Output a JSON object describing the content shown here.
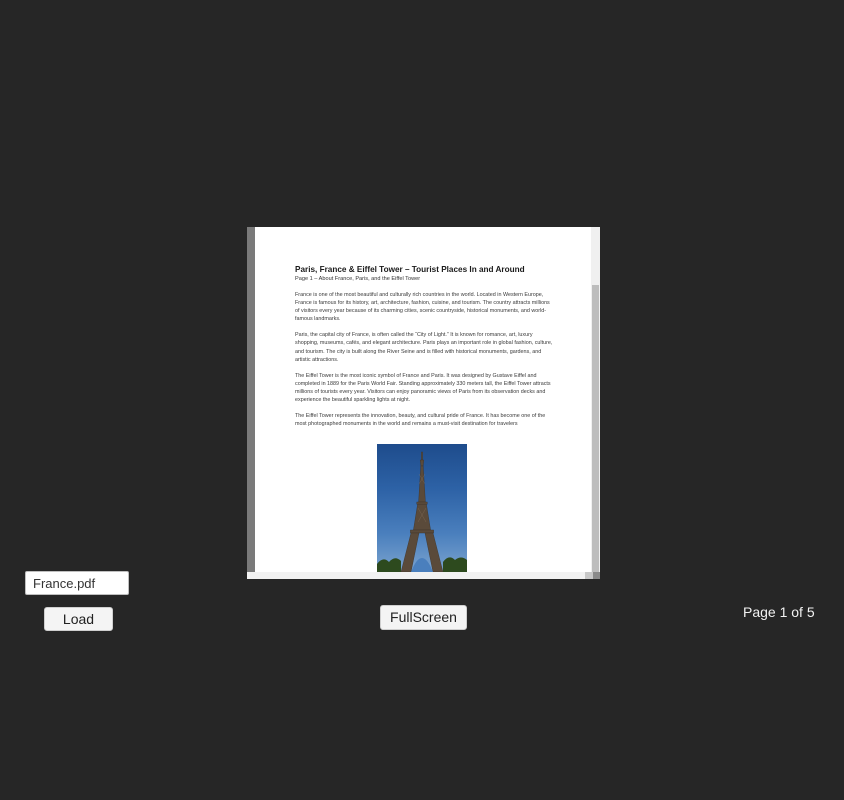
{
  "viewer": {
    "document": {
      "title": "Paris, France & Eiffel Tower – Tourist Places In and Around",
      "subtitle": "Page 1 – About France, Paris, and the Eiffel Tower",
      "paragraphs": [
        "France is one of the most beautiful and culturally rich countries in the world. Located in Western Europe, France is famous for its history, art, architecture, fashion, cuisine, and tourism. The country attracts millions of visitors every year because of its charming cities, scenic countryside, historical monuments, and world-famous landmarks.",
        "Paris, the capital city of France, is often called the “City of Light.” It is known for romance, art, luxury shopping, museums, cafés, and elegant architecture. Paris plays an important role in global fashion, culture, and tourism. The city is built along the River Seine and is filled with historical monuments, gardens, and artistic attractions.",
        "The Eiffel Tower is the most iconic symbol of France and Paris. It was designed by Gustave Eiffel and completed in 1889 for the Paris World Fair. Standing approximately 330 meters tall, the Eiffel Tower attracts millions of tourists every year. Visitors can enjoy panoramic views of Paris from its observation decks and experience the beautiful sparkling lights at night.",
        "The Eiffel Tower represents the innovation, beauty, and cultural pride of France. It has become one of the most photographed monuments in the world and remains a must-visit destination for travelers"
      ],
      "figure_icon": "eiffel-tower-photo"
    }
  },
  "controls": {
    "file_value": "France.pdf",
    "load_label": "Load",
    "fullscreen_label": "FullScreen",
    "page_indicator": "Page 1 of 5"
  },
  "colors": {
    "background": "#262626",
    "page": "#ffffff",
    "button": "#f4f4f4"
  }
}
